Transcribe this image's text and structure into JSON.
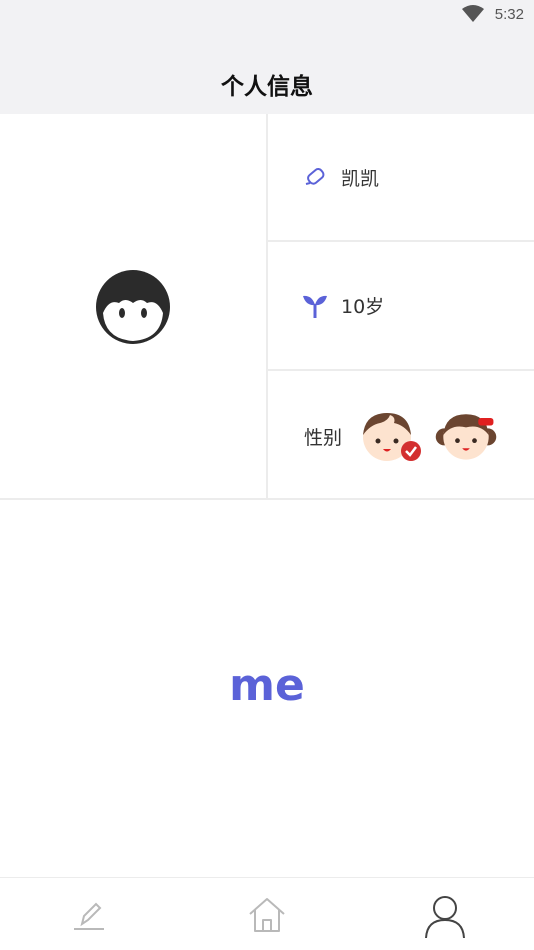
{
  "status_bar": {
    "time": "5:32",
    "wifi_icon": "wifi-icon"
  },
  "header": {
    "title": "个人信息"
  },
  "profile": {
    "avatar_icon": "cartoon-avatar-icon",
    "nickname": "凯凯",
    "nickname_icon": "edit-pencil-icon",
    "age": "10岁",
    "age_icon": "sprout-icon",
    "gender_label": "性别",
    "gender_options": [
      {
        "name": "boy",
        "icon": "boy-face-icon",
        "selected": true
      },
      {
        "name": "girl",
        "icon": "girl-face-icon",
        "selected": false
      }
    ]
  },
  "content": {
    "text": "me"
  },
  "tabbar": {
    "tabs": [
      {
        "name": "write",
        "icon": "pencil-icon",
        "active": false
      },
      {
        "name": "home",
        "icon": "home-icon",
        "active": false
      },
      {
        "name": "me",
        "icon": "person-icon",
        "active": true
      }
    ]
  },
  "colors": {
    "accent": "#5b62d8",
    "check": "#d32f2f",
    "header_bg": "#f2f2f4"
  }
}
